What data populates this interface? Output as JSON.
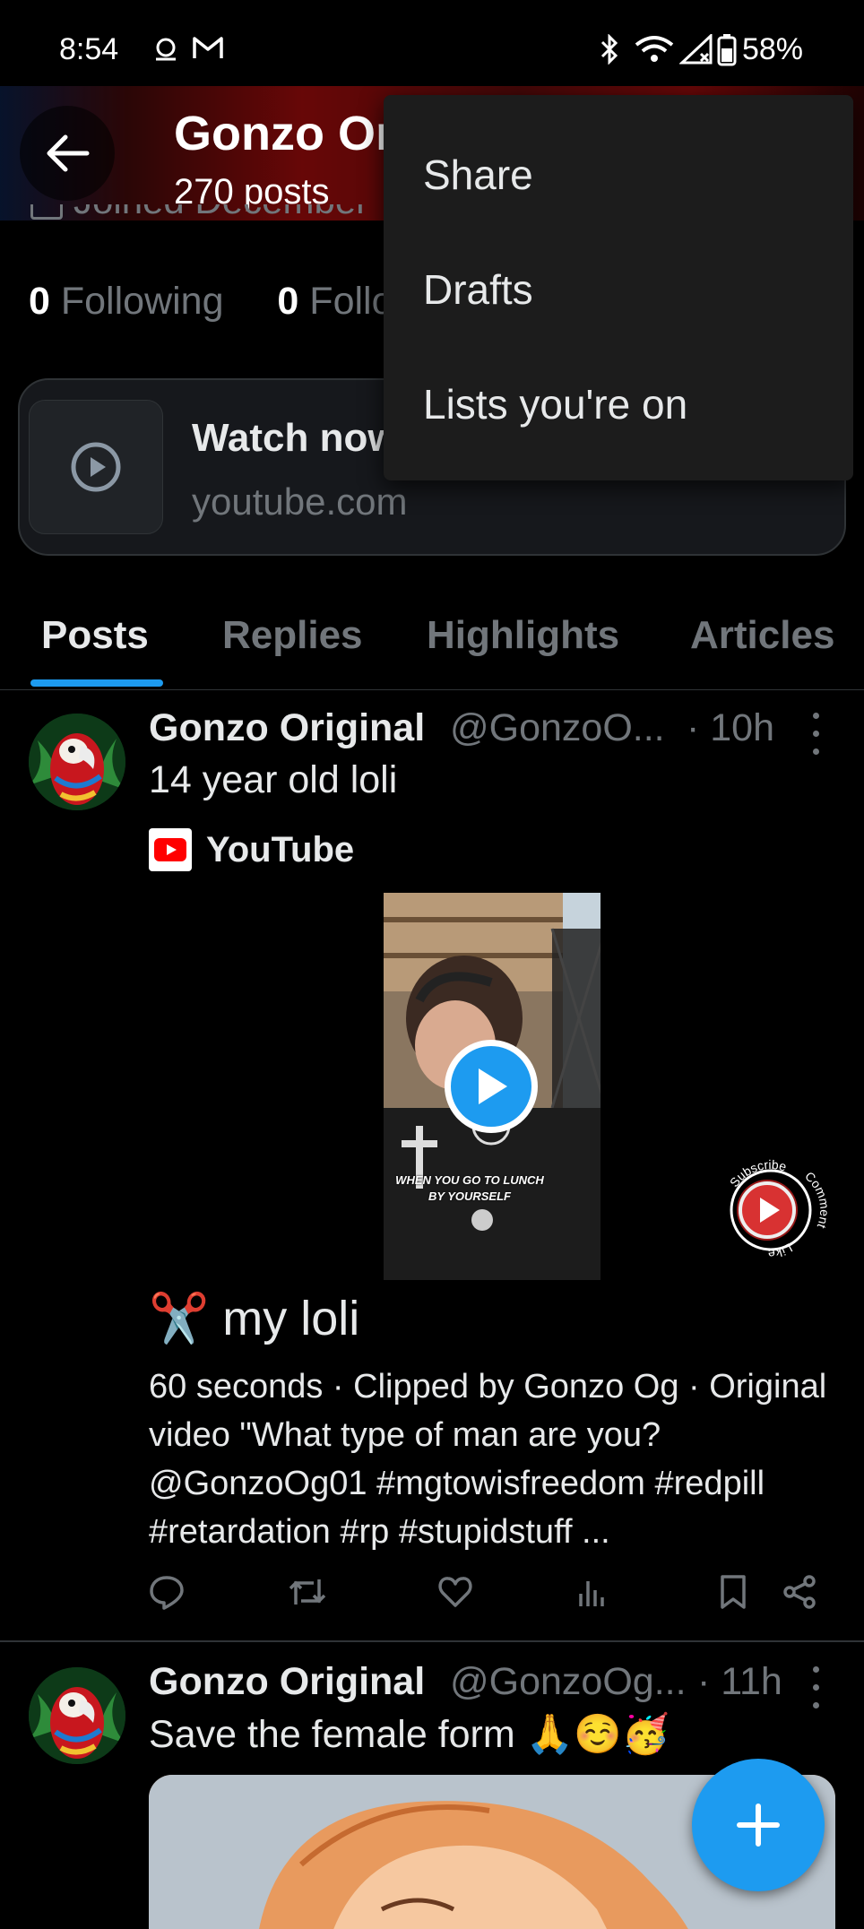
{
  "status_bar": {
    "time": "8:54",
    "battery": "58%"
  },
  "header": {
    "name": "Gonzo Original",
    "posts_count": "270 posts"
  },
  "profile": {
    "joined": "Joined December",
    "following_count": "0",
    "following_label": "Following",
    "followers_count": "0",
    "followers_label": "Followers"
  },
  "link_card": {
    "title": "Watch now",
    "domain": "youtube.com"
  },
  "tabs": [
    {
      "label": "Posts",
      "active": true
    },
    {
      "label": "Replies"
    },
    {
      "label": "Highlights"
    },
    {
      "label": "Articles"
    }
  ],
  "posts": [
    {
      "name": "Gonzo Original",
      "handle": "@GonzoO...",
      "time": "· 10h",
      "text": "14 year old loli",
      "card_source": "YouTube",
      "video_caption": "WHEN YOU GO TO LUNCH BY YOURSELF",
      "badge_texts": {
        "top": "Subscribe",
        "right": "Comment",
        "bottom": "Like"
      },
      "clip_title": "✂️ my loli",
      "clip_description": "60 seconds · Clipped by Gonzo Og · Original video \"What type of man are you?@GonzoOg01 #mgtowisfreedom #redpill #retardation #rp #stupidstuff ..."
    },
    {
      "name": "Gonzo Original",
      "handle": "@GonzoOg...",
      "time": "· 11h",
      "text": "Save the female form 🙏☺️🥳"
    }
  ],
  "menu": {
    "items": [
      {
        "label": "Share"
      },
      {
        "label": "Drafts"
      },
      {
        "label": "Lists you're on"
      }
    ]
  },
  "colors": {
    "accent": "#1d9bf0",
    "background": "#000000",
    "muted": "#71767b"
  }
}
